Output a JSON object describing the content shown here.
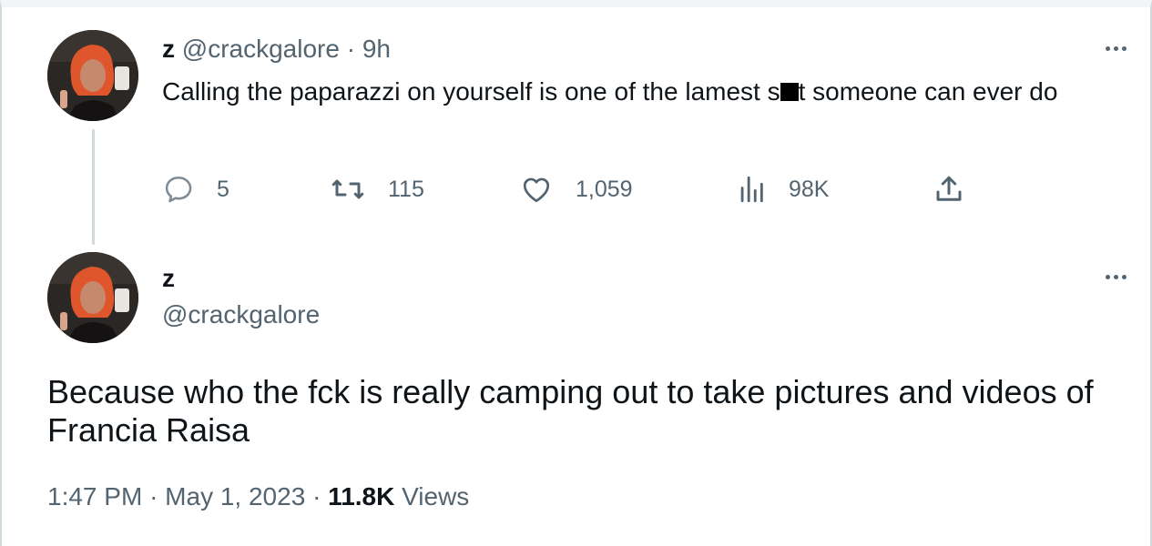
{
  "tweet1": {
    "name": "z",
    "handle": "@crackgalore",
    "separator": "·",
    "time": "9h",
    "text_part1": "Calling the paparazzi on yourself is one of the lamest s",
    "text_part2": "t someone can ever do",
    "actions": {
      "replies": "5",
      "retweets": "115",
      "likes": "1,059",
      "views": "98K"
    }
  },
  "tweet2": {
    "name": "z",
    "handle": "@crackgalore",
    "text": "Because who the fck is really camping out to take pictures and videos of Francia Raisa",
    "time": "1:47 PM",
    "date": "May 1, 2023",
    "separator": "·",
    "views_count": "11.8K",
    "views_label": "Views"
  },
  "icons": [
    "more-icon",
    "reply-icon",
    "retweet-icon",
    "like-icon",
    "analytics-icon",
    "share-icon"
  ],
  "colors": {
    "text": "#0f1419",
    "secondary": "#536471",
    "thread_line": "#cfd9de"
  }
}
